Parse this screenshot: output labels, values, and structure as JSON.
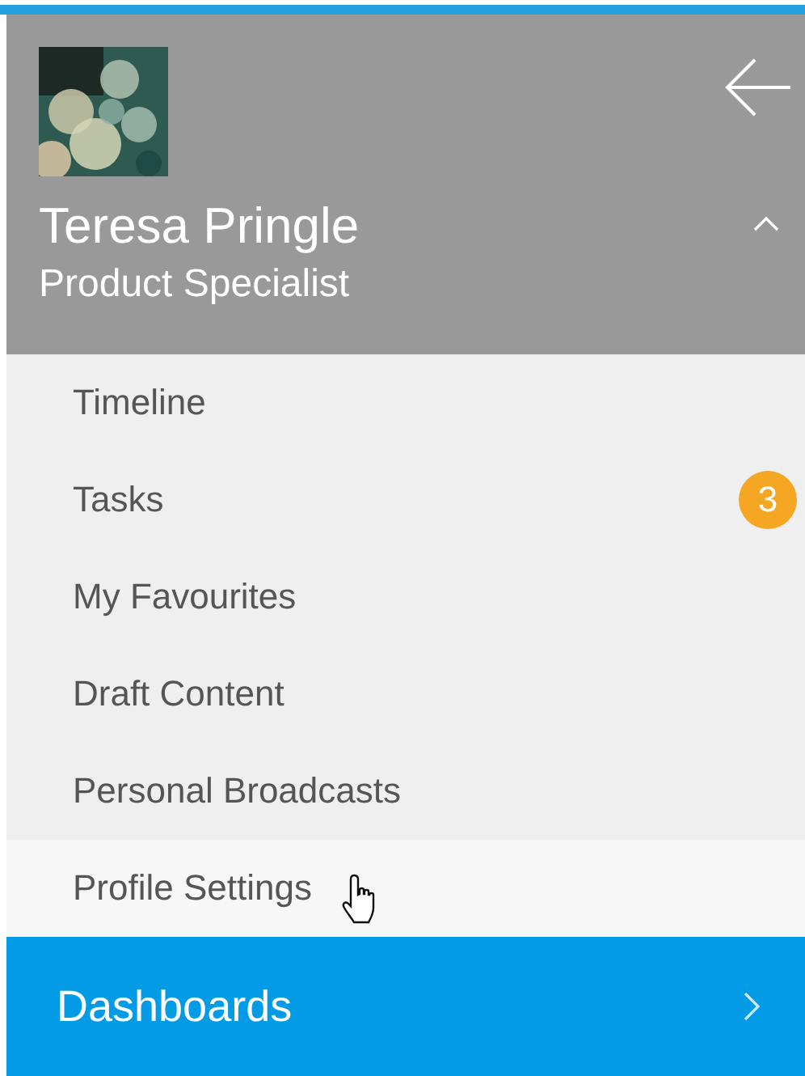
{
  "profile": {
    "name": "Teresa Pringle",
    "role": "Product Specialist",
    "expanded": true
  },
  "menu": [
    {
      "label": "Timeline",
      "hovered": false
    },
    {
      "label": "Tasks",
      "hovered": false,
      "badge": "3"
    },
    {
      "label": "My Favourites",
      "hovered": false
    },
    {
      "label": "Draft Content",
      "hovered": false
    },
    {
      "label": "Personal Broadcasts",
      "hovered": false
    },
    {
      "label": "Profile Settings",
      "hovered": true
    }
  ],
  "section": {
    "label": "Dashboards"
  }
}
